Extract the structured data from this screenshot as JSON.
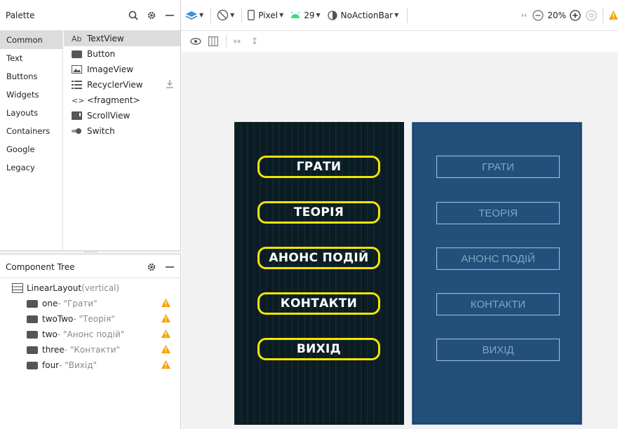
{
  "palette": {
    "title": "Palette",
    "categories": [
      "Common",
      "Text",
      "Buttons",
      "Widgets",
      "Layouts",
      "Containers",
      "Google",
      "Legacy"
    ],
    "selected_category": "Common",
    "items": [
      {
        "label": "TextView",
        "icon": "textview-icon",
        "icon_text": "Ab"
      },
      {
        "label": "Button",
        "icon": "button-icon"
      },
      {
        "label": "ImageView",
        "icon": "imageview-icon"
      },
      {
        "label": "RecyclerView",
        "icon": "recyclerview-icon"
      },
      {
        "label": "<fragment>",
        "icon": "fragment-icon",
        "icon_text": "<>"
      },
      {
        "label": "ScrollView",
        "icon": "scrollview-icon"
      },
      {
        "label": "Switch",
        "icon": "switch-icon"
      }
    ]
  },
  "component_tree": {
    "title": "Component Tree",
    "root": {
      "name": "LinearLayout",
      "detail": "(vertical)"
    },
    "children": [
      {
        "id": "one",
        "text": "- \"Грати\""
      },
      {
        "id": "twoTwo",
        "text": "- \"Теорія\""
      },
      {
        "id": "two",
        "text": "- \"Анонс подій\""
      },
      {
        "id": "three",
        "text": "- \"Контакти\""
      },
      {
        "id": "four",
        "text": "- \"Вихід\""
      }
    ]
  },
  "toolbar": {
    "device": "Pixel",
    "api_level": "29",
    "theme": "NoActionBar",
    "zoom": "20%"
  },
  "screen_buttons": [
    "ГРАТИ",
    "ТЕОРІЯ",
    "АНОНС ПОДІЙ",
    "КОНТАКТИ",
    "ВИХІД"
  ],
  "colors": {
    "design_background": "#0b1d24",
    "button_border": "#f5e400",
    "blueprint_background": "#23507a",
    "warning": "#f0a30a"
  }
}
